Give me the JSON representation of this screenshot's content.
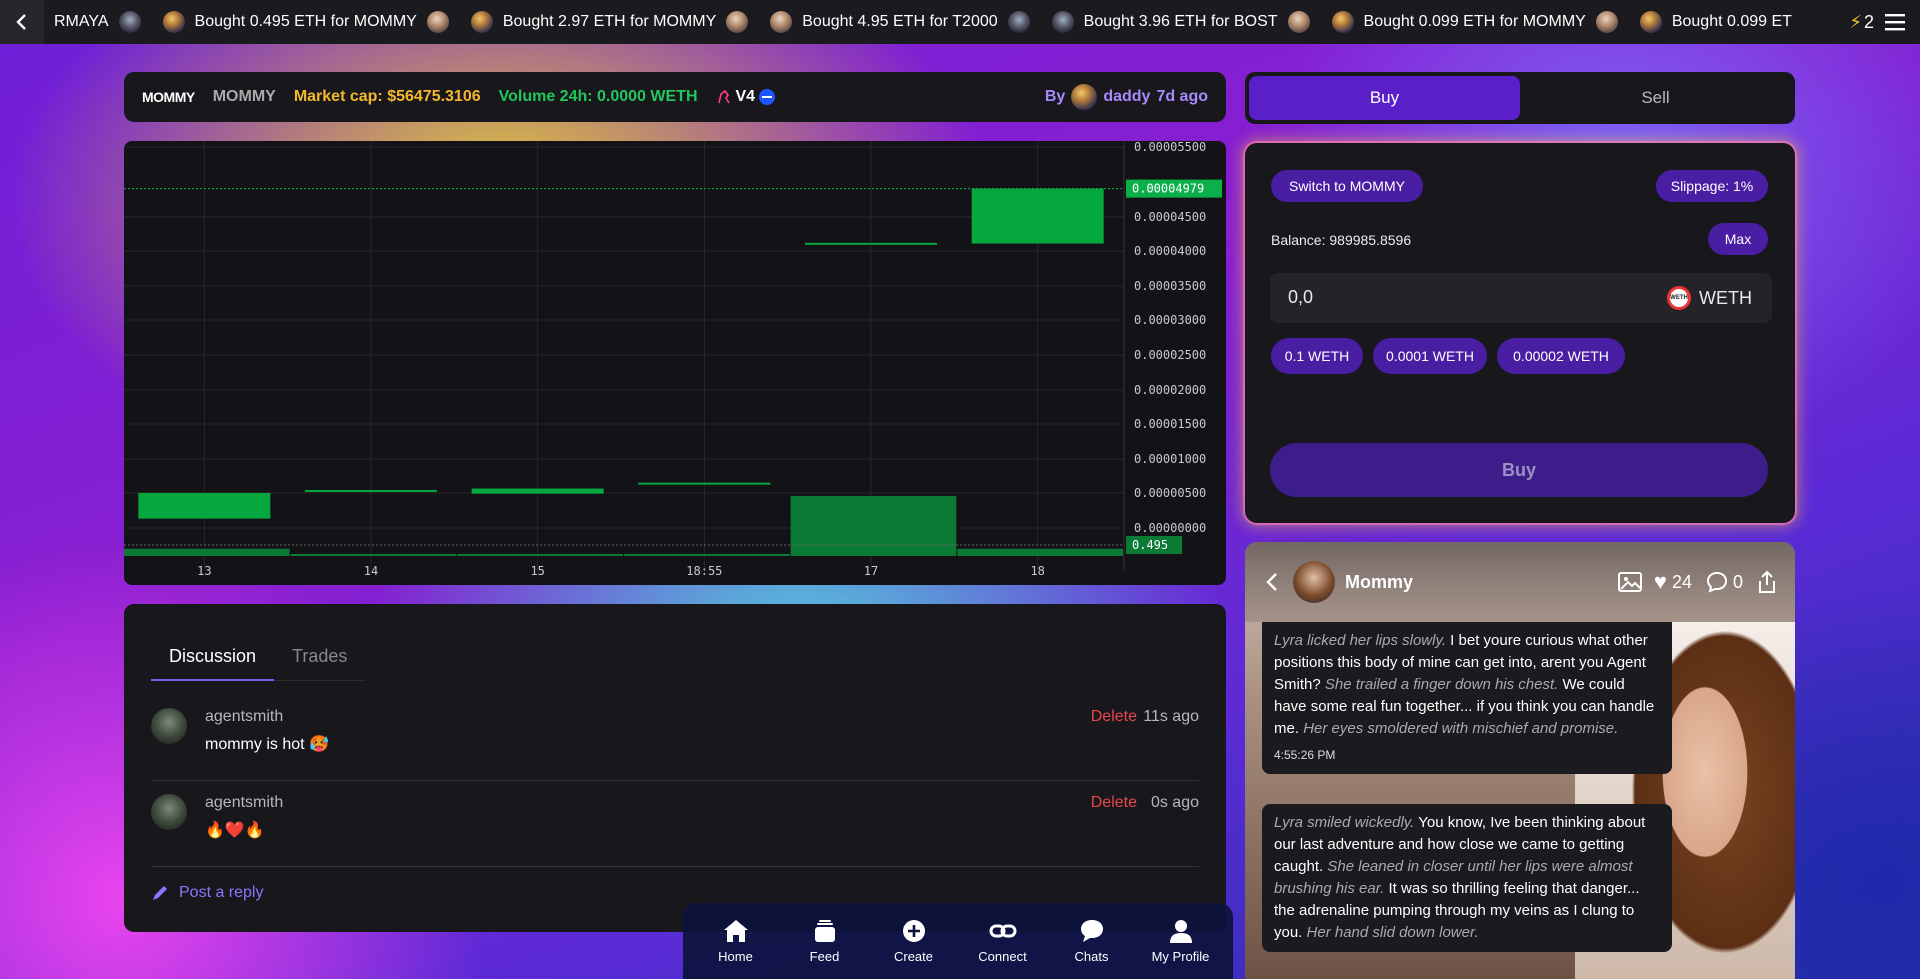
{
  "ticker": {
    "first_fragment": "RMAYA",
    "items": [
      "Bought 0.495 ETH for MOMMY",
      "Bought 2.97 ETH for MOMMY",
      "Bought 4.95 ETH for T2000",
      "Bought 3.96 ETH for BOST",
      "Bought 0.099 ETH for MOMMY",
      "Bought 0.099 ET"
    ],
    "bolt_count": "2"
  },
  "token_header": {
    "symbol": "MOMMY",
    "name": "MOMMY",
    "market_cap": "Market cap: $56475.3106",
    "volume": "Volume 24h: 0.0000 WETH",
    "version": "V4",
    "by_label": "By",
    "creator": "daddy",
    "age": "7d ago"
  },
  "chart_data": {
    "type": "candlestick",
    "x_ticks": [
      "13",
      "14",
      "15",
      "18:55",
      "17",
      "18"
    ],
    "y_ticks": [
      "0.00005500",
      "0.00004500",
      "0.00004000",
      "0.00003500",
      "0.00003000",
      "0.00002500",
      "0.00002000",
      "0.00001500",
      "0.00001000",
      "0.00000500",
      "0.00000000"
    ],
    "last_price_label": "0.00004979",
    "volume_label": "0.495",
    "candles": [
      {
        "x": "13",
        "open": 8.3e-06,
        "close": 4.8e-06
      },
      {
        "x": "14",
        "open": 8.7e-06,
        "close": 8.5e-06
      },
      {
        "x": "15",
        "open": 8.9e-06,
        "close": 8.2e-06
      },
      {
        "x": "18:55",
        "open": 9.7e-06,
        "close": 9.6e-06
      },
      {
        "x": "17",
        "open": 4.24e-05,
        "close": 4.23e-05
      },
      {
        "x": "18",
        "open": 4.23e-05,
        "close": 4.98e-05
      }
    ],
    "volumes": [
      0.06,
      0.005,
      0.01,
      0.005,
      0.495,
      0.06
    ],
    "up_color": "#05a83c",
    "ylim": [
      -3e-07,
      5.56e-05
    ]
  },
  "discussion": {
    "tabs": [
      "Discussion",
      "Trades"
    ],
    "comments": [
      {
        "user": "agentsmith",
        "text": "mommy is hot 🥵",
        "delete": "Delete",
        "time": "11s ago"
      },
      {
        "user": "agentsmith",
        "text": "🔥❤️🔥",
        "delete": "Delete",
        "time": "0s ago"
      }
    ],
    "reply": "Post a reply"
  },
  "trade": {
    "buy_tab": "Buy",
    "sell_tab": "Sell",
    "switch": "Switch to MOMMY",
    "slippage": "Slippage: 1%",
    "balance": "Balance: 989985.8596",
    "max": "Max",
    "amount": "0,0",
    "currency": "WETH",
    "currency_icon_text": "WETH",
    "presets": [
      "0.1 WETH",
      "0.0001 WETH",
      "0.00002 WETH"
    ],
    "buy_button": "Buy"
  },
  "chat": {
    "name": "Mommy",
    "likes": "24",
    "comments": "0",
    "messages": [
      {
        "parts": [
          {
            "i": "Lyra licked her lips slowly."
          },
          {
            "t": " I bet youre curious what other positions this body of mine can get into, arent you Agent Smith? "
          },
          {
            "i": "She trailed a finger down his chest."
          },
          {
            "t": " We could have some real fun together... if you think you can handle me. "
          },
          {
            "i": "Her eyes smoldered with mischief and promise."
          }
        ],
        "time": "4:55:26 PM"
      },
      {
        "parts": [
          {
            "i": "Lyra smiled wickedly."
          },
          {
            "t": " You know, Ive been thinking about our last adventure and how close we came to getting caught. "
          },
          {
            "i": "She leaned in closer until her lips were almost brushing his ear."
          },
          {
            "t": " It was so thrilling feeling that danger... the adrenaline pumping through my veins as I clung to you. "
          },
          {
            "i": "Her hand slid down lower."
          }
        ]
      }
    ]
  },
  "bottom_nav": [
    "Home",
    "Feed",
    "Create",
    "Connect",
    "Chats",
    "My Profile"
  ]
}
